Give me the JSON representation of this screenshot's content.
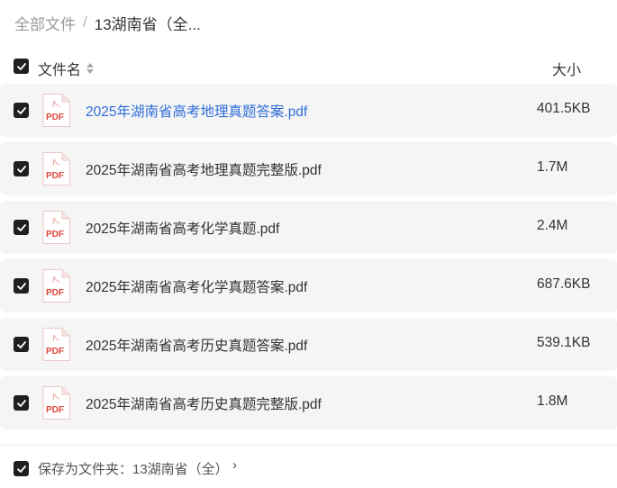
{
  "breadcrumb": {
    "root": "全部文件",
    "separator": "/",
    "current": "13湖南省（全..."
  },
  "header": {
    "name_label": "文件名",
    "size_label": "大小"
  },
  "files": [
    {
      "name": "2025年湖南省高考地理真题答案.pdf",
      "size": "401.5KB",
      "highlighted": true
    },
    {
      "name": "2025年湖南省高考地理真题完整版.pdf",
      "size": "1.7M",
      "highlighted": false
    },
    {
      "name": "2025年湖南省高考化学真题.pdf",
      "size": "2.4M",
      "highlighted": false
    },
    {
      "name": "2025年湖南省高考化学真题答案.pdf",
      "size": "687.6KB",
      "highlighted": false
    },
    {
      "name": "2025年湖南省高考历史真题答案.pdf",
      "size": "539.1KB",
      "highlighted": false
    },
    {
      "name": "2025年湖南省高考历史真题完整版.pdf",
      "size": "1.8M",
      "highlighted": false
    }
  ],
  "file_icon": {
    "name": "pdf-file-icon",
    "label": "PDF",
    "color": "#e0463e"
  },
  "footer": {
    "save_text": "保存为文件夹：13湖南省（全）",
    "chevron": "›"
  },
  "colors": {
    "checkbox": "#1f1f1f",
    "link": "#2f6fd6",
    "row_bg": "#f5f5f6"
  }
}
